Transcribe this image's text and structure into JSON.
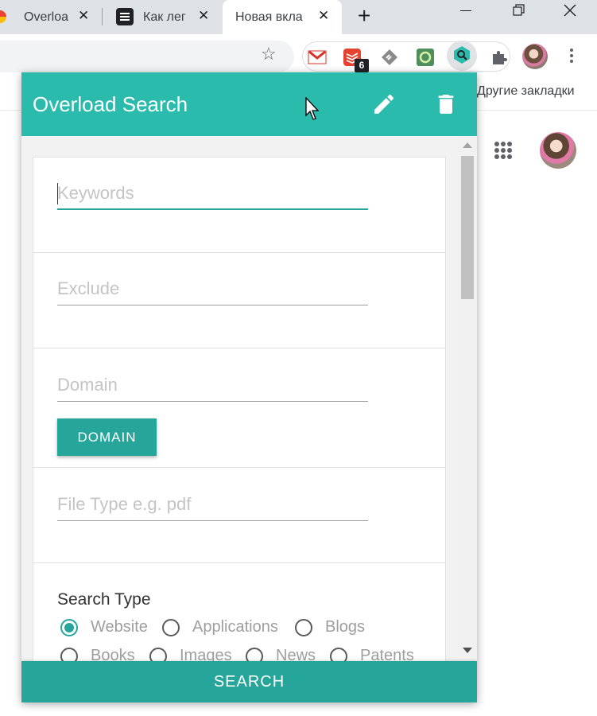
{
  "browser": {
    "tabs": [
      {
        "title": "Overloa",
        "close": "✕"
      },
      {
        "title": "Как лег",
        "close": "✕"
      },
      {
        "title": "Новая вкла",
        "close": "✕",
        "active": true
      }
    ],
    "new_tab_glyph": "+",
    "window_controls": {
      "minimize": "—",
      "restore": "❐",
      "close": "✕"
    },
    "extension_badge": "6",
    "other_bookmarks": "Другие закладки"
  },
  "popup": {
    "title": "Overload Search",
    "header_icons": [
      "pencil-icon",
      "trash-icon"
    ],
    "fields": {
      "keywords_placeholder": "Keywords",
      "exclude_placeholder": "Exclude",
      "domain_placeholder": "Domain",
      "filetype_placeholder": "File Type e.g. pdf"
    },
    "domain_button": "DOMAIN",
    "search_type": {
      "label": "Search Type",
      "options": [
        "Website",
        "Applications",
        "Blogs",
        "Books",
        "Images",
        "News",
        "Patents"
      ],
      "selected": "Website"
    },
    "search_button": "SEARCH"
  },
  "colors": {
    "header": "#2bbbad",
    "accent": "#26a69a",
    "tabstrip": "#dee1e6"
  }
}
